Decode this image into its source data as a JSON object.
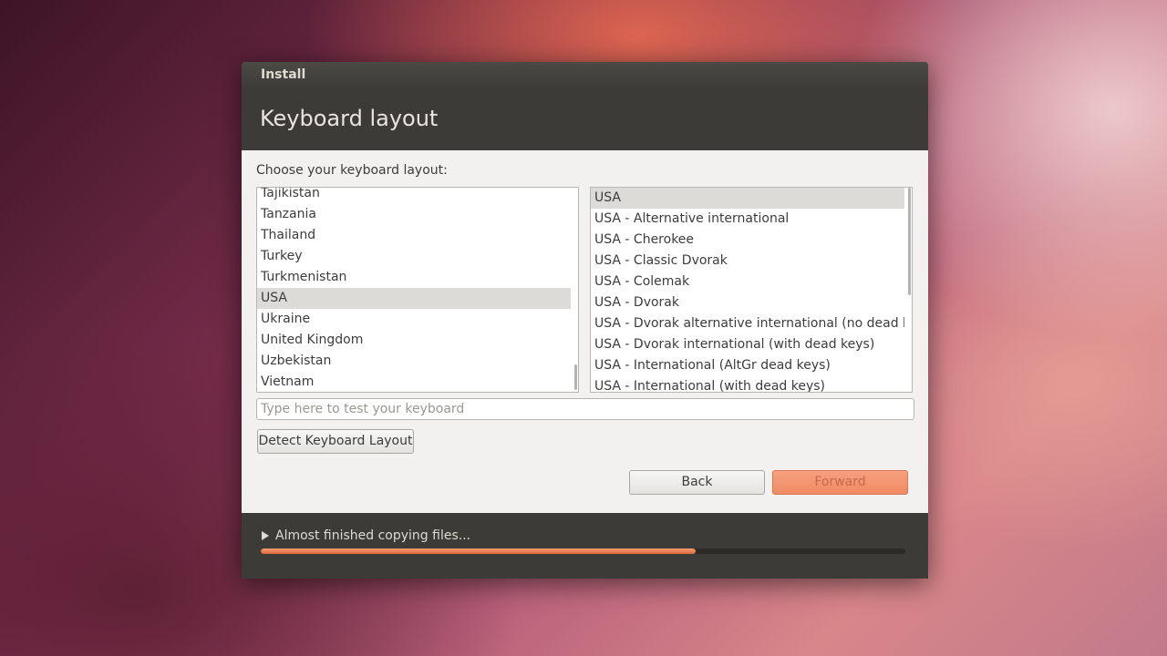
{
  "window": {
    "title": "Install",
    "page_title": "Keyboard layout"
  },
  "layout_chooser": {
    "label": "Choose your keyboard layout:",
    "countries": [
      "Tajikistan",
      "Tanzania",
      "Thailand",
      "Turkey",
      "Turkmenistan",
      "USA",
      "Ukraine",
      "United Kingdom",
      "Uzbekistan",
      "Vietnam"
    ],
    "selected_country": "USA",
    "variants": [
      "USA",
      "USA - Alternative international",
      "USA - Cherokee",
      "USA - Classic Dvorak",
      "USA - Colemak",
      "USA - Dvorak",
      "USA - Dvorak alternative international (no dead keys)",
      "USA - Dvorak international (with dead keys)",
      "USA - International (AltGr dead keys)",
      "USA - International (with dead keys)"
    ],
    "selected_variant": "USA"
  },
  "test_field": {
    "placeholder": "Type here to test your keyboard",
    "value": ""
  },
  "buttons": {
    "detect": "Detect Keyboard Layout",
    "back": "Back",
    "forward": "Forward"
  },
  "progress": {
    "status": "Almost finished copying files...",
    "fraction": 0.675
  },
  "colors": {
    "accent": "#ef8b63",
    "window_dark": "#3c3b37",
    "selection": "#dcdbd8"
  }
}
